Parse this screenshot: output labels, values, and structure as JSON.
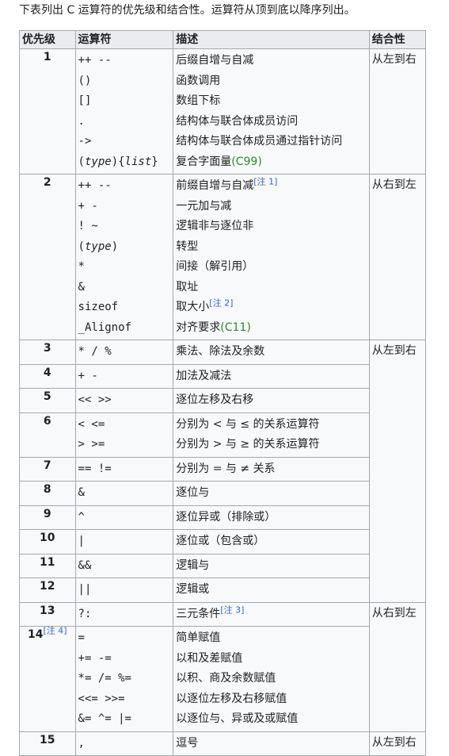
{
  "intro": "下表列出 C 运算符的优先级和结合性。运算符从顶到底以降序列出。",
  "headers": {
    "precedence": "优先级",
    "operator": "运算符",
    "description": "描述",
    "associativity": "结合性"
  },
  "groups": [
    {
      "precedence": "1",
      "assoc": "从左到右",
      "rows": [
        {
          "op": "++ --",
          "desc": "后缀自增与自减"
        },
        {
          "op": "()",
          "desc": "函数调用"
        },
        {
          "op": "[]",
          "desc": "数组下标"
        },
        {
          "op": ".",
          "desc": "结构体与联合体成员访问"
        },
        {
          "op": "->",
          "desc": "结构体与联合体成员通过指针访问"
        },
        {
          "op": "(type){list}",
          "desc": "复合字面量",
          "std": "(C99)"
        }
      ]
    },
    {
      "precedence": "2",
      "assoc": "从右到左",
      "rows": [
        {
          "op": "++ --",
          "desc": "前缀自增与自减",
          "note": "[注 1]"
        },
        {
          "op": "+ -",
          "desc": "一元加与减"
        },
        {
          "op": "! ~",
          "desc": "逻辑非与逐位非"
        },
        {
          "op": "(type)",
          "desc": "转型"
        },
        {
          "op": "*",
          "desc": "间接（解引用）"
        },
        {
          "op": "&",
          "desc": "取址"
        },
        {
          "op": "sizeof",
          "desc": "取大小",
          "note": "[注 2]"
        },
        {
          "op": "_Alignof",
          "desc": "对齐要求",
          "std": "(C11)"
        }
      ]
    },
    {
      "precedence": "3",
      "assoc": "从左到右",
      "rows": [
        {
          "op": "* / %",
          "desc": "乘法、除法及余数"
        }
      ]
    },
    {
      "precedence": "4",
      "rows": [
        {
          "op": "+ -",
          "desc": "加法及减法"
        }
      ]
    },
    {
      "precedence": "5",
      "rows": [
        {
          "op": "<< >>",
          "desc": "逐位左移及右移"
        }
      ]
    },
    {
      "precedence": "6",
      "rows": [
        {
          "op": "< <=",
          "desc": "分别为 < 与 ≤ 的关系运算符"
        },
        {
          "op": "> >=",
          "desc": "分别为 > 与 ≥ 的关系运算符"
        }
      ]
    },
    {
      "precedence": "7",
      "rows": [
        {
          "op": "== !=",
          "desc": "分别为 = 与 ≠ 关系"
        }
      ]
    },
    {
      "precedence": "8",
      "rows": [
        {
          "op": "&",
          "desc": "逐位与"
        }
      ]
    },
    {
      "precedence": "9",
      "rows": [
        {
          "op": "^",
          "desc": "逐位异或（排除或）"
        }
      ]
    },
    {
      "precedence": "10",
      "rows": [
        {
          "op": "|",
          "desc": "逐位或（包含或）"
        }
      ]
    },
    {
      "precedence": "11",
      "rows": [
        {
          "op": "&&",
          "desc": "逻辑与"
        }
      ]
    },
    {
      "precedence": "12",
      "rows": [
        {
          "op": "||",
          "desc": "逻辑或"
        }
      ]
    },
    {
      "precedence": "13",
      "assoc": "从右到左",
      "rows": [
        {
          "op": "?:",
          "desc": "三元条件",
          "note": "[注 3]"
        }
      ]
    },
    {
      "precedence": "14",
      "precNote": "[注 4]",
      "rows": [
        {
          "op": "=",
          "desc": "简单赋值"
        },
        {
          "op": "+= -=",
          "desc": "以和及差赋值"
        },
        {
          "op": "*= /= %=",
          "desc": "以积、商及余数赋值"
        },
        {
          "op": "<<= >>=",
          "desc": "以逐位左移及右移赋值"
        },
        {
          "op": "&= ^= |=",
          "desc": "以逐位与、异或及或赋值"
        }
      ]
    },
    {
      "precedence": "15",
      "assoc": "从左到右",
      "rows": [
        {
          "op": ",",
          "desc": "逗号"
        }
      ]
    }
  ]
}
